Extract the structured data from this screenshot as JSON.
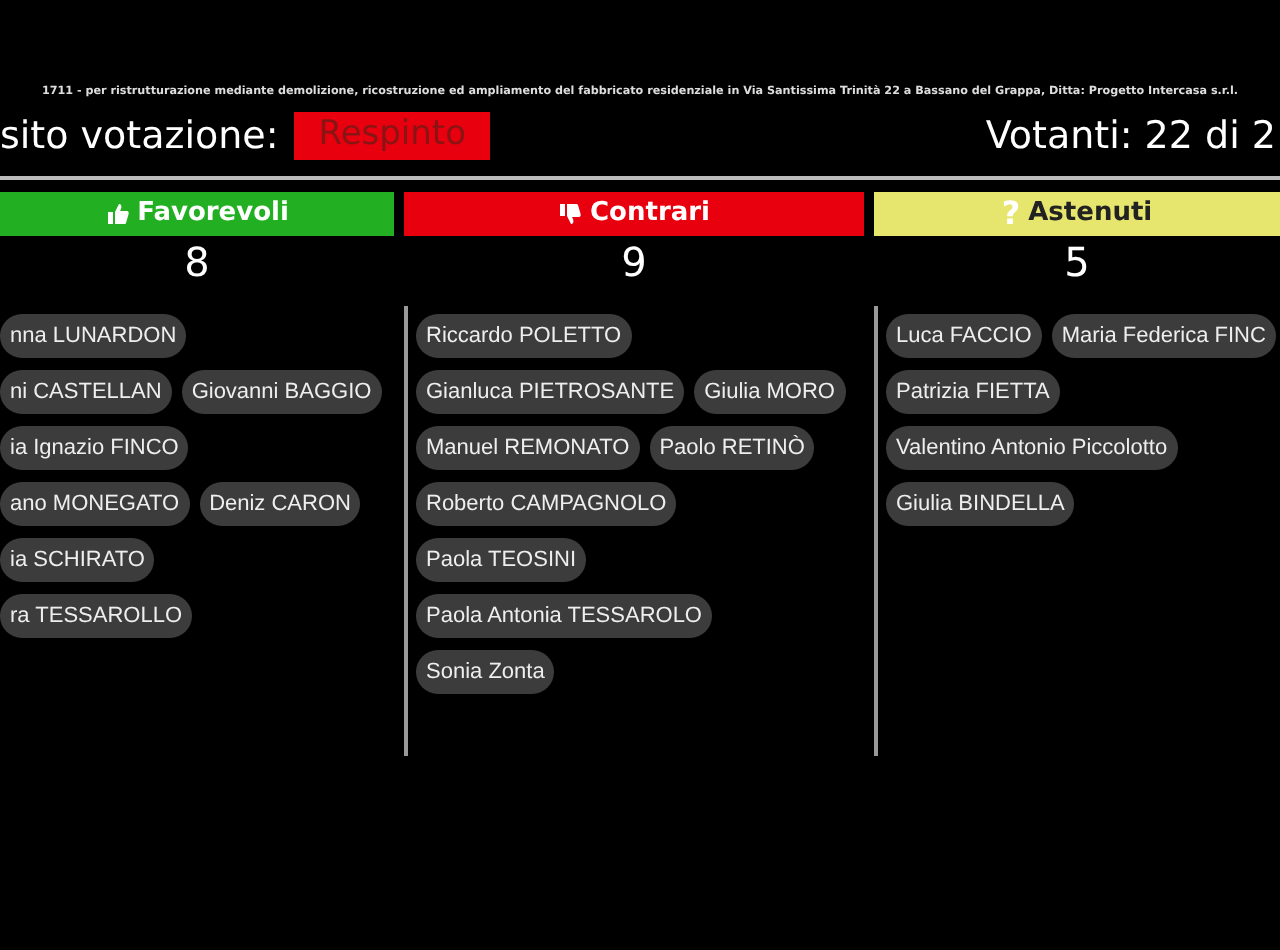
{
  "subject": "1711 - per ristrutturazione mediante demolizione, ricostruzione ed ampliamento del fabbricato residenziale in Via Santissima Trinità 22 a Bassano del Grappa, Ditta: Progetto Intercasa s.r.l.",
  "outcome": {
    "label": "sito votazione:",
    "result": "Respinto"
  },
  "voters": "Votanti: 22 di 2",
  "columns": [
    {
      "kind": "favor",
      "title": "Favorevoli",
      "color": "#22b022",
      "count": "8",
      "rows": [
        [
          "nna LUNARDON"
        ],
        [
          "ni CASTELLAN",
          "Giovanni BAGGIO"
        ],
        [
          "ia Ignazio FINCO"
        ],
        [
          "ano MONEGATO",
          "Deniz CARON"
        ],
        [
          "ia SCHIRATO"
        ],
        [
          "ra TESSAROLLO"
        ]
      ]
    },
    {
      "kind": "against",
      "title": "Contrari",
      "color": "#e8000f",
      "count": "9",
      "rows": [
        [
          "Riccardo POLETTO"
        ],
        [
          "Gianluca PIETROSANTE",
          "Giulia MORO"
        ],
        [
          "Manuel REMONATO",
          "Paolo RETINÒ"
        ],
        [
          "Roberto CAMPAGNOLO"
        ],
        [
          "Paola TEOSINI"
        ],
        [
          "Paola Antonia TESSAROLO"
        ],
        [
          "Sonia Zonta"
        ]
      ]
    },
    {
      "kind": "abstain",
      "title": "Astenuti",
      "icon_char": "?",
      "color": "#e6e66e",
      "count": "5",
      "rows": [
        [
          "Luca FACCIO",
          "Maria Federica FINC"
        ],
        [
          "Patrizia FIETTA"
        ],
        [
          "Valentino Antonio Piccolotto"
        ],
        [
          "Giulia BINDELLA"
        ]
      ]
    }
  ]
}
